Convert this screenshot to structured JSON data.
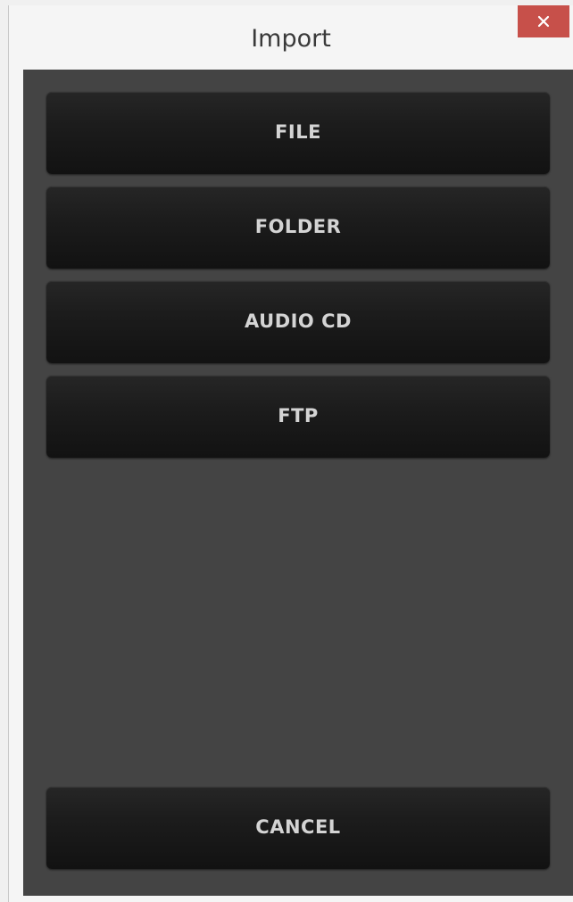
{
  "window": {
    "title": "Import",
    "close_icon": "close-icon",
    "close_color": "#c7504a"
  },
  "options": [
    {
      "label": "FILE"
    },
    {
      "label": "FOLDER"
    },
    {
      "label": "AUDIO CD"
    },
    {
      "label": "FTP"
    }
  ],
  "cancel_label": "CANCEL",
  "colors": {
    "panel_background": "#444444",
    "button_background": "#1c1c1c",
    "button_text": "#d4d4d4"
  }
}
